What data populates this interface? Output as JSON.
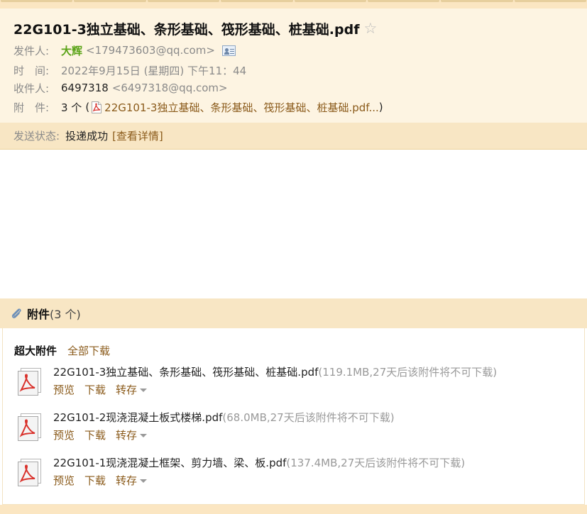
{
  "subject": "22G101-3独立基础、条形基础、筏形基础、桩基础.pdf",
  "star_glyph": "☆",
  "from": {
    "label": "发件人:",
    "name": "大辉",
    "email": "<179473603@qq.com>"
  },
  "time": {
    "label": "时　间:",
    "value": "2022年9月15日 (星期四) 下午11：44"
  },
  "to": {
    "label": "收件人:",
    "name": "6497318",
    "email": "<6497318@qq.com>"
  },
  "attachments_summary": {
    "label": "附　件:",
    "count": "3 个",
    "open": "(",
    "link": "22G101-3独立基础、条形基础、筏形基础、桩基础.pdf...",
    "close": ")"
  },
  "send_status": {
    "label": "发送状态:",
    "value": "投递成功",
    "detail_link": "[查看详情]"
  },
  "attachments_section": {
    "title": "附件",
    "count": "(3 个)",
    "big_label": "超大附件",
    "download_all": "全部下载",
    "files": [
      {
        "name": "22G101-3独立基础、条形基础、筏形基础、桩基础.pdf",
        "size": "(119.1MB,27天后该附件将不可下载)",
        "preview": "预览",
        "download": "下载",
        "save": "转存"
      },
      {
        "name": "22G101-2现浇混凝土板式楼梯.pdf",
        "size": "(68.0MB,27天后该附件将不可下载)",
        "preview": "预览",
        "download": "下载",
        "save": "转存"
      },
      {
        "name": "22G101-1现浇混凝土框架、剪力墙、梁、板.pdf",
        "size": "(137.4MB,27天后该附件将不可下载)",
        "preview": "预览",
        "download": "下载",
        "save": "转存"
      }
    ]
  },
  "colors": {
    "sender_green": "#5aa317",
    "link_brown": "#8a5a1a",
    "header_bg": "#fdf4e2",
    "status_bg": "#f8e6c4",
    "pdf_red": "#d9312b"
  },
  "icons": {
    "star": "star-icon",
    "contact": "contact-card-icon",
    "paperclip": "paperclip-icon",
    "pdf": "pdf-file-icon",
    "caret": "chevron-down-icon"
  }
}
